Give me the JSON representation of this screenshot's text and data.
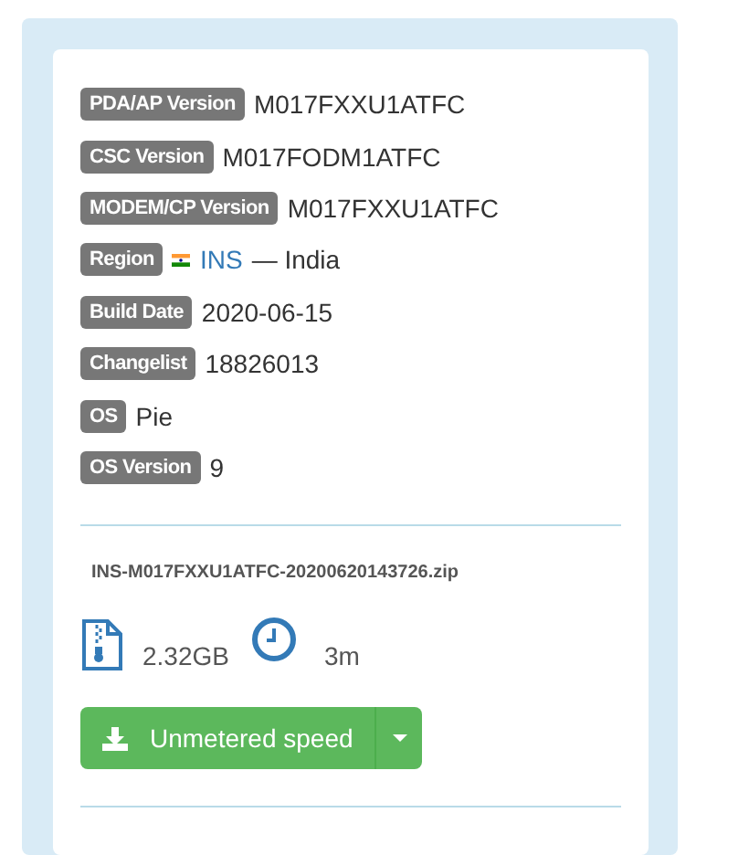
{
  "details": [
    {
      "kind": "text",
      "label": "PDA/AP Version",
      "value": "M017FXXU1ATFC"
    },
    {
      "kind": "text",
      "label": "CSC Version",
      "value": "M017FODM1ATFC"
    },
    {
      "kind": "text",
      "label": "MODEM/CP Version",
      "value": "M017FXXU1ATFC"
    },
    {
      "kind": "region",
      "label": "Region",
      "link": "INS",
      "value": "— India"
    },
    {
      "kind": "text",
      "label": "Build Date",
      "value": "2020-06-15"
    },
    {
      "kind": "text",
      "label": "Changelist",
      "value": "18826013"
    },
    {
      "kind": "text",
      "label": "OS",
      "value": "Pie"
    },
    {
      "kind": "text",
      "label": "OS Version",
      "value": "9"
    }
  ],
  "file": {
    "name": "INS-M017FXXU1ATFC-20200620143726.zip",
    "size": "2.32GB",
    "time": "3m"
  },
  "download_button": {
    "label": "Unmetered speed"
  }
}
